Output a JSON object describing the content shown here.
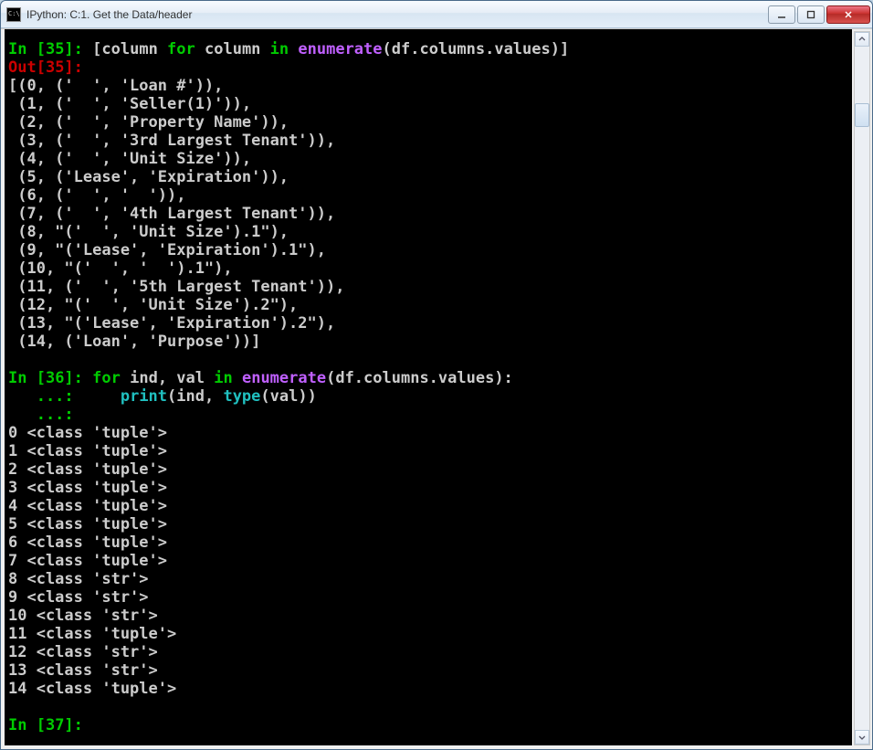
{
  "window": {
    "title": "IPython: C:1. Get the Data/header"
  },
  "prompt35_in": "In ",
  "prompt35_num": "[35]",
  "prompt35_colon": ": ",
  "code35_a": "[column ",
  "code35_for": "for",
  "code35_b": " column ",
  "code35_in": "in",
  "code35_c": " ",
  "code35_enum": "enumerate",
  "code35_d": "(df.columns.values)]",
  "out35_label": "Out",
  "out35_num": "[35]",
  "out35_colon": ":",
  "out35_lines": [
    "[(0, ('  ', 'Loan #')),",
    " (1, ('  ', 'Seller(1)')),",
    " (2, ('  ', 'Property Name')),",
    " (3, ('  ', '3rd Largest Tenant')),",
    " (4, ('  ', 'Unit Size')),",
    " (5, ('Lease', 'Expiration')),",
    " (6, ('  ', '  ')),",
    " (7, ('  ', '4th Largest Tenant')),",
    " (8, \"('  ', 'Unit Size').1\"),",
    " (9, \"('Lease', 'Expiration').1\"),",
    " (10, \"('  ', '  ').1\"),",
    " (11, ('  ', '5th Largest Tenant')),",
    " (12, \"('  ', 'Unit Size').2\"),",
    " (13, \"('Lease', 'Expiration').2\"),",
    " (14, ('Loan', 'Purpose'))]"
  ],
  "prompt36_in": "In ",
  "prompt36_num": "[36]",
  "prompt36_colon": ": ",
  "code36_for": "for",
  "code36_a": " ind, val ",
  "code36_in": "in",
  "code36_b": " ",
  "code36_enum": "enumerate",
  "code36_c": "(df.columns.values):",
  "cont36": "   ...:",
  "code36_indent": "     ",
  "code36_print": "print",
  "code36_d": "(ind, ",
  "code36_type": "type",
  "code36_e": "(val))",
  "out36_lines": [
    "0 <class 'tuple'>",
    "1 <class 'tuple'>",
    "2 <class 'tuple'>",
    "3 <class 'tuple'>",
    "4 <class 'tuple'>",
    "5 <class 'tuple'>",
    "6 <class 'tuple'>",
    "7 <class 'tuple'>",
    "8 <class 'str'>",
    "9 <class 'str'>",
    "10 <class 'str'>",
    "11 <class 'tuple'>",
    "12 <class 'str'>",
    "13 <class 'str'>",
    "14 <class 'tuple'>"
  ],
  "prompt37_in": "In ",
  "prompt37_num": "[37]",
  "prompt37_colon": ":"
}
